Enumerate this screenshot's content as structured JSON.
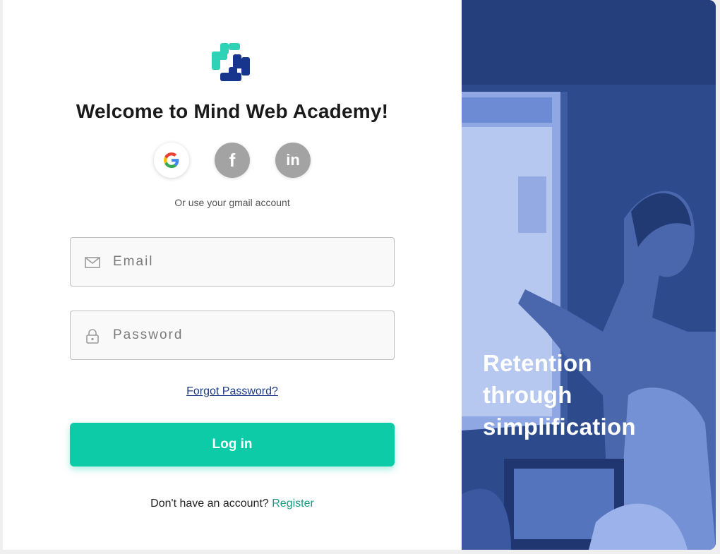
{
  "login": {
    "title": "Welcome to Mind Web Academy!",
    "social_hint": "Or use your gmail account",
    "social": [
      {
        "name": "google",
        "icon": "google-icon"
      },
      {
        "name": "facebook",
        "icon": "facebook-icon",
        "glyph": "f"
      },
      {
        "name": "linkedin",
        "icon": "linkedin-icon",
        "glyph": "in"
      }
    ],
    "email": {
      "placeholder": "Email",
      "value": "",
      "icon": "mail-icon"
    },
    "password": {
      "placeholder": "Password",
      "value": "",
      "icon": "lock-icon"
    },
    "forgot_label": "Forgot Password?",
    "login_label": "Log in",
    "no_account_text": "Don't have an account?",
    "register_label": "Register"
  },
  "hero": {
    "tagline_lines": [
      "Retention",
      "through",
      "simplification"
    ]
  },
  "colors": {
    "accent": "#0ccba6",
    "link": "#1c3b86",
    "register_link": "#1a9a82",
    "hero_overlay": "#2d4a8c",
    "logo_teal": "#2ed3b7",
    "logo_navy": "#17358c"
  }
}
